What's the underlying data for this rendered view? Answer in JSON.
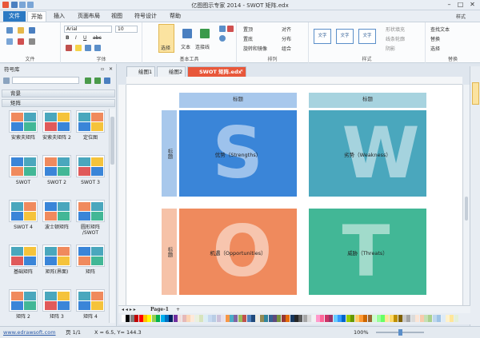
{
  "title_bar": {
    "title": "亿图图示专家 2014 - SWOT 矩阵.edx",
    "min": "–",
    "max": "□",
    "close": "✕"
  },
  "tabs": [
    {
      "label": "文件"
    },
    {
      "label": "开始"
    },
    {
      "label": "插入"
    },
    {
      "label": "页面布局"
    },
    {
      "label": "视图"
    },
    {
      "label": "符号设计"
    },
    {
      "label": "帮助"
    }
  ],
  "ribbon": {
    "groups": {
      "file": "文件",
      "font": "字体",
      "basic_tools": "基本工具",
      "arrange": "排列",
      "style": "样式",
      "replace": "替换"
    },
    "font_name": "Arial",
    "font_size": "10",
    "bold": "B",
    "italic": "I",
    "underline": "U",
    "strike": "abc",
    "select_label": "选择",
    "text_label": "文本",
    "connector_label": "连接线",
    "arrange_items": [
      "置顶",
      "置底",
      "旋转和镜像",
      "对齐",
      "分布",
      "组合"
    ],
    "textbox_label": "文字",
    "style_items": [
      "形状填充",
      "线条轮廓",
      "阴影"
    ],
    "replace_items": [
      "查找文本",
      "替换",
      "选择"
    ],
    "style_right": "样式"
  },
  "panel": {
    "title": "符号库",
    "pin": "▫",
    "close": "✕",
    "combo_value": "",
    "cat_background": "背景",
    "cat_matrix": "矩阵",
    "thumbs": [
      {
        "label": "安索夫矩阵"
      },
      {
        "label": "安索夫矩阵 2"
      },
      {
        "label": "定位图"
      },
      {
        "label": "SWOT"
      },
      {
        "label": "SWOT 2"
      },
      {
        "label": "SWOT 3"
      },
      {
        "label": "SWOT 4"
      },
      {
        "label": "波士顿矩阵"
      },
      {
        "label": "圆形矩阵 /SWOT"
      },
      {
        "label": "基础矩阵"
      },
      {
        "label": "矩阵(界面)"
      },
      {
        "label": "矩阵"
      },
      {
        "label": "矩阵 2"
      },
      {
        "label": "矩阵 3"
      },
      {
        "label": "矩阵 4"
      }
    ]
  },
  "doc_tabs": [
    {
      "label": "绘图1"
    },
    {
      "label": "绘图2"
    },
    {
      "label": "SWOT 矩阵.edx",
      "close": "✕"
    }
  ],
  "swot": {
    "quadrants": [
      {
        "header": "标题",
        "side": "标题",
        "letter": "S",
        "label": "优势（Strengths）",
        "color": "#3a85d8",
        "light": "#a8c8ec"
      },
      {
        "header": "标题",
        "side": "",
        "letter": "W",
        "label": "劣势（Weakness）",
        "color": "#4aa7bd",
        "light": "#a7d3df"
      },
      {
        "header": "",
        "side": "标题",
        "letter": "O",
        "label": "机遇（Opportunities）",
        "color": "#ef8a5d",
        "light": "#f6c2a8"
      },
      {
        "header": "",
        "side": "",
        "letter": "T",
        "label": "威胁（Threats）",
        "color": "#42b796",
        "light": ""
      }
    ]
  },
  "page_tab": {
    "label": "Page-1",
    "add": "+"
  },
  "status": {
    "url": "www.edrawsoft.com",
    "page": "页 1/1",
    "coords": "X = 6.5, Y= 144.3",
    "zoom": "100%"
  },
  "palette_colors": [
    "#ffffff",
    "#000000",
    "#7f7f7f",
    "#c00000",
    "#ff0000",
    "#ffc000",
    "#ffff00",
    "#92d050",
    "#00b050",
    "#00b0f0",
    "#0070c0",
    "#002060",
    "#7030a0",
    "#f2dcdb",
    "#e6b9b8",
    "#fbd5b5",
    "#fde9d9",
    "#ebf1de",
    "#d7e4bd",
    "#dbeef4",
    "#c6d9f1",
    "#b9cde5",
    "#ccc1da",
    "#e6e0ec",
    "#f79646",
    "#4bacc6",
    "#8064a2",
    "#9bbb59",
    "#c0504d",
    "#4f81bd",
    "#1f497d",
    "#eeece1",
    "#948a54",
    "#31859c",
    "#366092",
    "#604a7b",
    "#76923c",
    "#953735",
    "#e46c0a",
    "#17375e",
    "#262626",
    "#595959",
    "#a6a6a6",
    "#d9d9d9",
    "#f2f2f2",
    "#ff99cc",
    "#ff6699",
    "#cc3366",
    "#993366",
    "#66ccff",
    "#3399ff",
    "#0066cc",
    "#99cc00",
    "#669900",
    "#ffcc66",
    "#ff9933",
    "#cc6600",
    "#996633",
    "#ccffcc",
    "#99ff99",
    "#66ff66",
    "#ffe699",
    "#ffd966",
    "#bf9000",
    "#7f6000",
    "#c9c9c9",
    "#a5a5a5",
    "#dbdbdb",
    "#fbe5d6",
    "#f8cbad",
    "#c5e0b4",
    "#a9d18e",
    "#bdd7ee",
    "#9dc3e6",
    "#deebf7",
    "#fff2cc",
    "#ffe699",
    "#e2f0d9"
  ]
}
